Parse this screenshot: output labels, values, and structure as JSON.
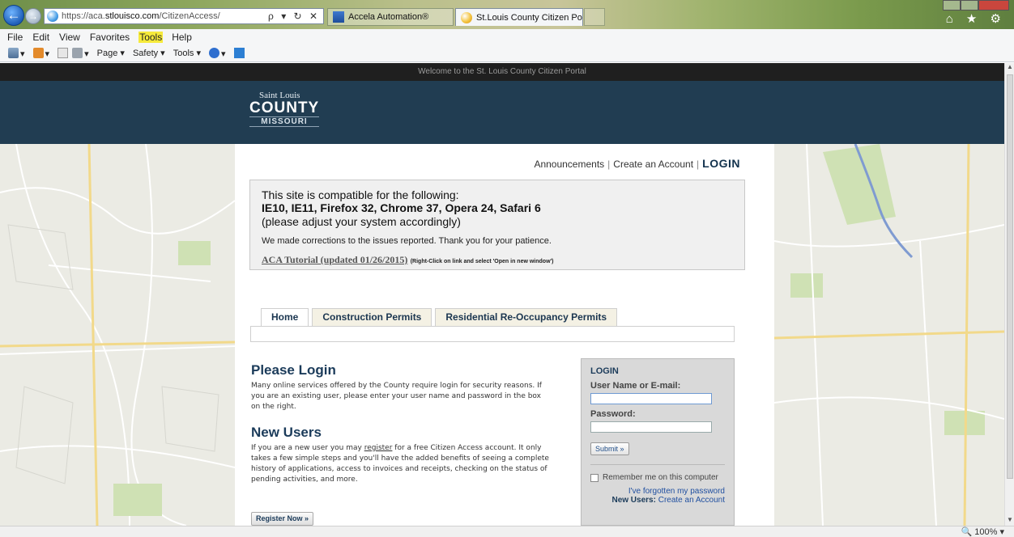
{
  "browser": {
    "url_prefix": "https://aca.",
    "url_domain": "stlouisco.com",
    "url_path": "/CitizenAccess/",
    "address_icons": "ρ ▾ ↻ ✕",
    "tabs": [
      {
        "label": "Accela Automation®",
        "active": false,
        "icon": "accela-icon"
      },
      {
        "label": "St.Louis County Citizen Port...",
        "active": true,
        "icon": "ie-page-icon"
      }
    ],
    "tab_close": "✕",
    "right_icons": "⌂ ★ ⚙",
    "menu": [
      "File",
      "Edit",
      "View",
      "Favorites",
      "Tools",
      "Help"
    ],
    "highlighted_menu": "Tools",
    "command_bar": [
      "▾",
      "▾",
      "▾",
      "Page ▾",
      "Safety ▾",
      "Tools ▾",
      "▾"
    ],
    "zoom": "🔍 100% ▾"
  },
  "page": {
    "welcome": "Welcome to the St. Louis County Citizen Portal",
    "logo": {
      "line1": "Saint Louis",
      "line2": "COUNTY",
      "line3": "MISSOURI"
    },
    "top_links": {
      "announcements": "Announcements",
      "create_account": "Create an Account",
      "login": "LOGIN",
      "separator": "|"
    },
    "notice": {
      "line1": "This site is compatible for the following:",
      "line2": "IE10, IE11, Firefox 32, Chrome 37, Opera 24, Safari 6",
      "line3": "(please adjust your system accordingly)",
      "line4": "We made corrections to the issues reported. Thank you for your patience.",
      "tutorial_link": "ACA Tutorial (updated 01/26/2015)",
      "tutorial_hint": "(Right-Click on link and select 'Open in new window')"
    },
    "tabs": [
      "Home",
      "Construction Permits",
      "Residential Re-Occupancy Permits"
    ],
    "please_login": {
      "title": "Please Login",
      "text": "Many online services offered by the County require login for security reasons. If you are an existing user, please enter your user name and password in the box on the right."
    },
    "new_users": {
      "title": "New Users",
      "text_before": "If you are a new user you may ",
      "register_link": "register",
      "text_after": " for a free Citizen Access account. It only takes a few simple steps and you'll have the added benefits of seeing a complete history of applications, access to invoices and receipts, checking on the status of pending activities, and more."
    },
    "register_button": "Register Now »",
    "login_box": {
      "title": "LOGIN",
      "username_label": "User Name or E-mail:",
      "username_value": "",
      "password_label": "Password:",
      "password_value": "",
      "submit": "Submit »",
      "remember": "Remember me on this computer",
      "forgot": "I've forgotten my password",
      "new_users_label": "New Users:",
      "create_account": "Create an Account"
    }
  }
}
